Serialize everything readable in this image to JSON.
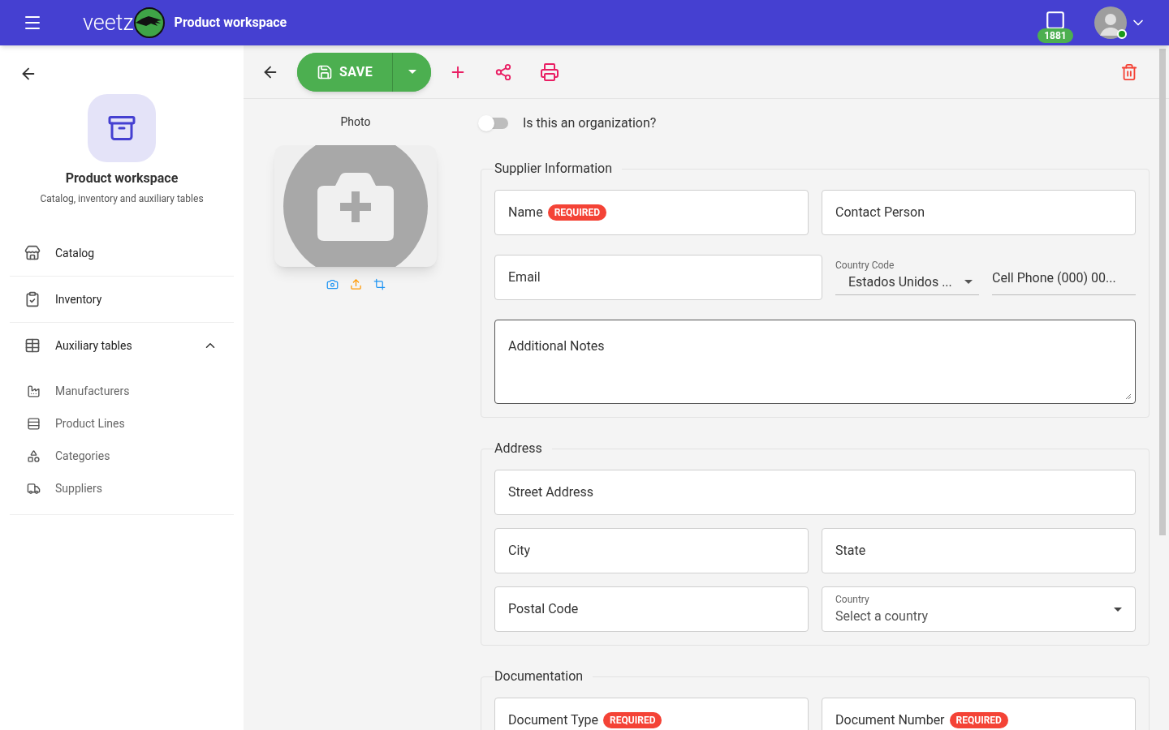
{
  "header": {
    "app_name": "veetz",
    "title": "Product workspace",
    "notification_count": "1881",
    "online": true
  },
  "sidebar": {
    "title": "Product workspace",
    "subtitle": "Catalog, inventory and auxiliary tables",
    "items": [
      {
        "label": "Catalog"
      },
      {
        "label": "Inventory"
      },
      {
        "label": "Auxiliary tables",
        "expanded": true,
        "children": [
          {
            "label": "Manufacturers"
          },
          {
            "label": "Product Lines"
          },
          {
            "label": "Categories"
          },
          {
            "label": "Suppliers"
          }
        ]
      }
    ]
  },
  "toolbar": {
    "save_label": "SAVE"
  },
  "photo": {
    "label": "Photo"
  },
  "organization_toggle": {
    "label": "Is this an organization?",
    "on": false
  },
  "sections": [
    {
      "title": "Supplier Information",
      "rows": [
        [
          {
            "kind": "text",
            "label": "Name",
            "badge": "REQUIRED"
          },
          {
            "kind": "text",
            "label": "Contact Person"
          }
        ],
        [
          {
            "kind": "text",
            "label": "Email"
          },
          {
            "kind": "phone",
            "label": "Country Code",
            "value": "Estados Unidos ...",
            "placeholder": "Cell Phone (000) 00..."
          }
        ],
        [
          {
            "kind": "textarea",
            "label": "Additional Notes"
          }
        ]
      ]
    },
    {
      "title": "Address",
      "rows": [
        [
          {
            "kind": "text",
            "label": "Street Address"
          }
        ],
        [
          {
            "kind": "text",
            "label": "City"
          },
          {
            "kind": "text",
            "label": "State"
          }
        ],
        [
          {
            "kind": "text",
            "label": "Postal Code"
          },
          {
            "kind": "select",
            "label": "Country",
            "placeholder": "Select a country"
          }
        ]
      ]
    },
    {
      "title": "Documentation",
      "rows": [
        [
          {
            "kind": "text",
            "label": "Document Type",
            "badge": "REQUIRED"
          },
          {
            "kind": "text",
            "label": "Document Number",
            "badge": "REQUIRED"
          }
        ]
      ]
    }
  ]
}
